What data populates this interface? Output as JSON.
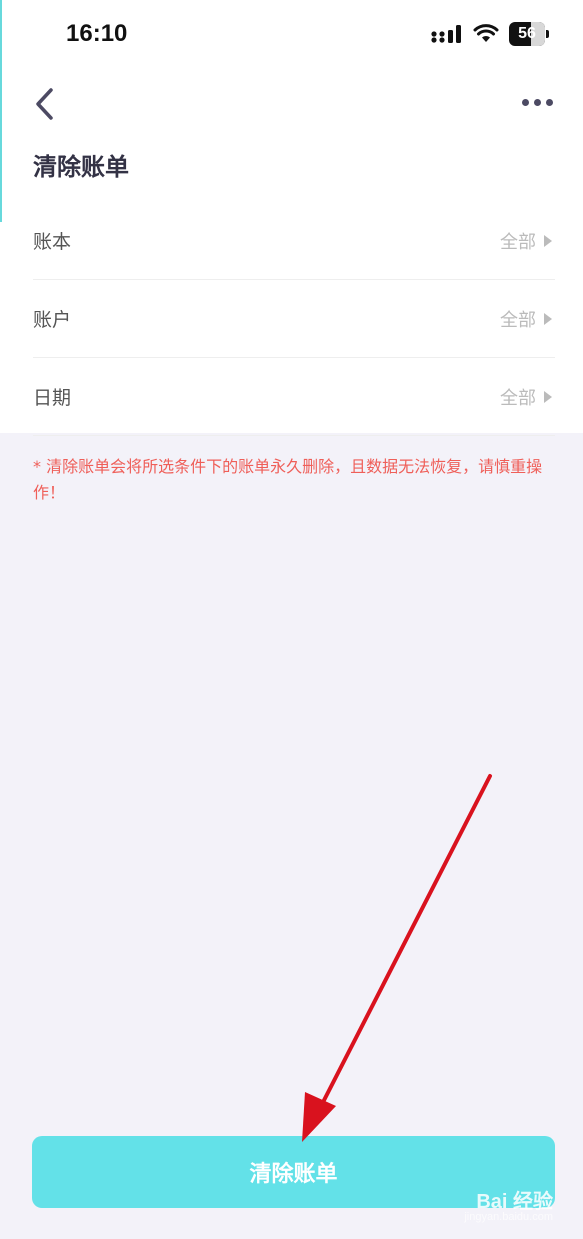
{
  "status_bar": {
    "time": "16:10",
    "battery": "56"
  },
  "nav": {
    "back_icon": "chevron-left-icon",
    "more_icon": "more-dots-icon"
  },
  "page": {
    "title": "清除账单"
  },
  "filters": [
    {
      "label": "账本",
      "value": "全部"
    },
    {
      "label": "账户",
      "value": "全部"
    },
    {
      "label": "日期",
      "value": "全部"
    }
  ],
  "warning": "* 清除账单会将所选条件下的账单永久删除，且数据无法恢复，请慎重操作！",
  "action": {
    "clear_label": "清除账单"
  },
  "watermark": {
    "brand": "Bai 经验",
    "url": "jingyan.baidu.com"
  },
  "colors": {
    "accent": "#63e1e8",
    "warning": "#ef5f59",
    "annotation_arrow": "#d9121e"
  }
}
